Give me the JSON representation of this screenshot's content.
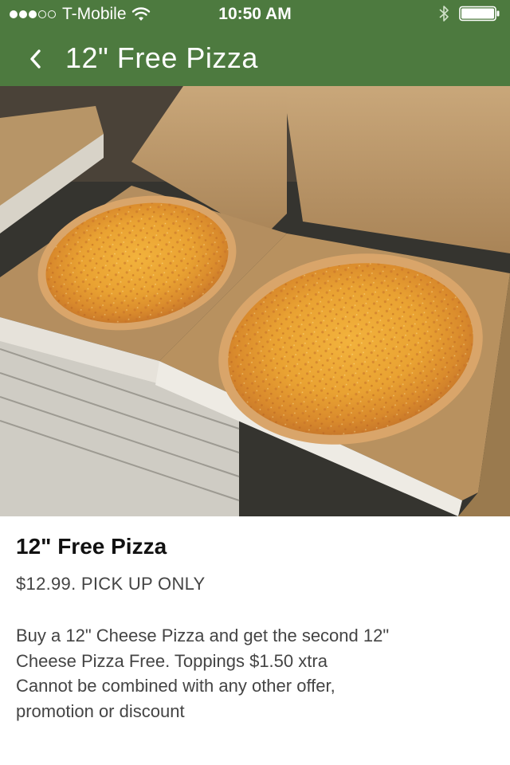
{
  "status_bar": {
    "carrier": "T-Mobile",
    "time": "10:50 AM",
    "signal_bars": 3,
    "signal_total": 5,
    "icons": [
      "wifi-icon",
      "bluetooth-icon",
      "battery-icon"
    ],
    "battery_level": 1.0
  },
  "nav": {
    "back_icon": "chevron-left-icon",
    "title": "12\" Free Pizza"
  },
  "photo": {
    "subject": "two cheese pizzas in open boxes"
  },
  "item": {
    "title": "12\" Free Pizza",
    "price_line": "$12.99. PICK UP ONLY",
    "description_lines": [
      "Buy a 12\" Cheese Pizza and get the second 12\"",
      "Cheese Pizza Free. Toppings $1.50 xtra",
      "Cannot be combined with any other offer,",
      "promotion or discount"
    ]
  },
  "colors": {
    "header_bg": "#4d7a3f",
    "header_text": "#ffffff",
    "title_text": "#111111",
    "body_text": "#444444"
  }
}
